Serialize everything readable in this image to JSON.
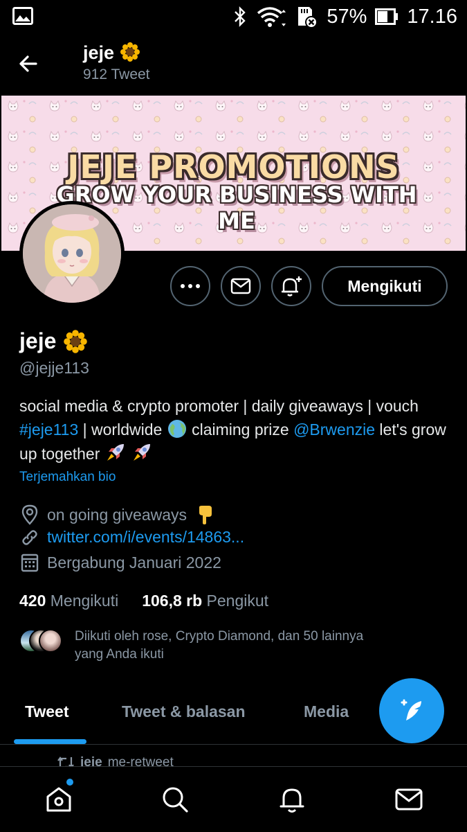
{
  "status_bar": {
    "battery": "57%",
    "time": "17.16"
  },
  "header": {
    "name": "jeje",
    "tweet_count": "912 Tweet"
  },
  "banner": {
    "title": "JEJE PROMOTIONS",
    "subtitle": "GROW YOUR BUSINESS WITH ME"
  },
  "actions": {
    "follow_label": "Mengikuti"
  },
  "profile": {
    "name": "jeje",
    "handle": "@jejje113",
    "bio_1": "social media & crypto promoter | daily giveaways | vouch ",
    "bio_hashtag": "#jeje113",
    "bio_2": " | worldwide ",
    "bio_3": " claiming prize ",
    "bio_mention": "@Brwenzie",
    "bio_4": " let's grow up together ",
    "translate_label": "Terjemahkan bio",
    "location": "on going giveaways",
    "link": "twitter.com/i/events/14863...",
    "joined": "Bergabung Januari 2022",
    "following_count": "420",
    "following_label": "Mengikuti",
    "followers_count": "106,8 rb",
    "followers_label": "Pengikut",
    "followed_by_1": "Diikuti oleh rose, Crypto Diamond, dan 50 lainnya",
    "followed_by_2": "yang Anda ikuti"
  },
  "tabs": [
    {
      "label": "Tweet",
      "active": true
    },
    {
      "label": "Tweet & balasan",
      "active": false
    },
    {
      "label": "Media",
      "active": false
    }
  ],
  "peek": {
    "name": "jeje",
    "action": "me-retweet"
  },
  "icons": {
    "verified_emoji": "sunflower",
    "nav": [
      "home-icon",
      "search-icon",
      "notifications-icon",
      "messages-icon"
    ]
  },
  "colors": {
    "accent": "#1d9bf0",
    "background": "#000000",
    "muted": "#8b98a5"
  }
}
